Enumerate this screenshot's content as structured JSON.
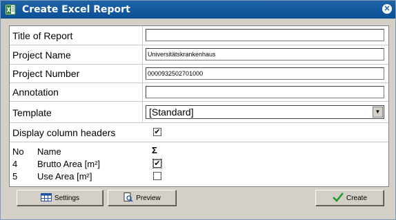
{
  "window": {
    "title": "Create Excel Report"
  },
  "form": {
    "title_label": "Title of Report",
    "title_value": "",
    "project_name_label": "Project Name",
    "project_name_value": "Universitätskrankenhaus",
    "project_number_label": "Project Number",
    "project_number_value": "0000932502701000",
    "annotation_label": "Annotation",
    "annotation_value": "",
    "template_label": "Template",
    "template_value": "[Standard]",
    "display_headers_label": "Display column headers",
    "display_headers_checked": true
  },
  "columns_list": {
    "header_no": "No",
    "header_name": "Name",
    "header_sum": "Σ",
    "rows": [
      {
        "no": "4",
        "name": "Brutto Area [m²]",
        "sum_checked": true
      },
      {
        "no": "5",
        "name": "Use Area [m²]",
        "sum_checked": false
      }
    ]
  },
  "buttons": {
    "settings_label": "Settings",
    "preview_label": "Preview",
    "create_label": "Create"
  },
  "icons": {
    "window_icon": "excel-icon",
    "close_icon": "close-icon",
    "settings_icon": "table-icon",
    "preview_icon": "preview-icon",
    "create_icon": "checkmark-icon"
  }
}
